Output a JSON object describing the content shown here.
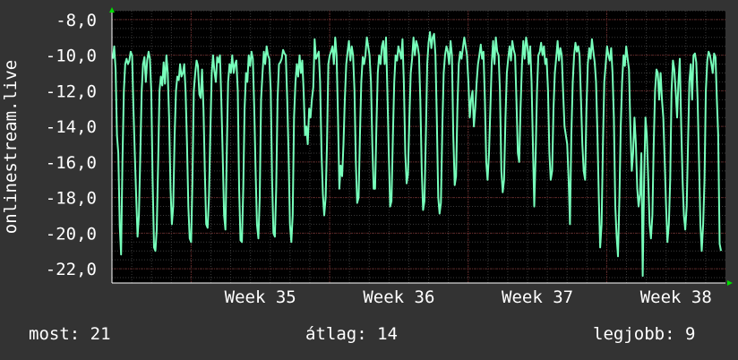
{
  "chart_data": {
    "type": "line",
    "ylabel": "onlinestream.live",
    "ylim": [
      -22.8,
      -7.5
    ],
    "y_ticks": [
      "-8,0",
      "-10,0",
      "-12,0",
      "-14,0",
      "-16,0",
      "-18,0",
      "-20,0",
      "-22,0"
    ],
    "y_tick_values": [
      -8,
      -10,
      -12,
      -14,
      -16,
      -18,
      -20,
      -22
    ],
    "x_labels": [
      "Week 35",
      "Week 36",
      "Week 37",
      "Week 38"
    ],
    "x_label_days": [
      7.5,
      14.5,
      21.5,
      28.5
    ],
    "x_range_days": [
      0,
      31
    ],
    "grid": true,
    "colors": {
      "background": "#333333",
      "plot": "#000000",
      "line": "#77ffbb",
      "grid_minor": "#3a3a3a",
      "grid_major": "#6b2424",
      "axis": "#ffffff",
      "arrow": "#00dd00"
    },
    "series": [
      {
        "values": [
          -10.2,
          -9.5,
          -10.8,
          -14.5,
          -15.5,
          -19.6,
          -21.2,
          -16.0,
          -12.0,
          -10.5,
          -10.2,
          -10.5,
          -10.3,
          -9.8,
          -10.0,
          -13.0,
          -15.5,
          -18.0,
          -20.2,
          -19.0,
          -15.5,
          -12.0,
          -10.5,
          -10.1,
          -11.5,
          -10.3,
          -9.8,
          -10.2,
          -12.0,
          -17.0,
          -20.8,
          -21.0,
          -19.8,
          -16.0,
          -12.0,
          -11.2,
          -11.7,
          -10.4,
          -11.6,
          -10.0,
          -11.0,
          -13.5,
          -17.5,
          -19.5,
          -18.5,
          -14.5,
          -12.0,
          -11.2,
          -11.4,
          -10.5,
          -11.2,
          -11.0,
          -10.5,
          -12.0,
          -15.0,
          -18.5,
          -20.3,
          -20.5,
          -17.0,
          -12.0,
          -11.0,
          -10.3,
          -10.6,
          -12.2,
          -12.4,
          -10.8,
          -13.0,
          -16.5,
          -19.5,
          -19.7,
          -18.0,
          -14.5,
          -11.0,
          -10.0,
          -10.9,
          -11.5,
          -10.1,
          -10.4,
          -10.0,
          -12.5,
          -15.5,
          -19.0,
          -19.8,
          -15.5,
          -11.5,
          -10.5,
          -11.0,
          -10.0,
          -11.0,
          -10.5,
          -10.3,
          -12.0,
          -17.5,
          -20.4,
          -20.5,
          -17.5,
          -13.0,
          -11.0,
          -11.5,
          -10.0,
          -10.6,
          -9.8,
          -10.2,
          -13.0,
          -16.5,
          -19.5,
          -20.3,
          -18.0,
          -12.5,
          -11.0,
          -9.8,
          -10.5,
          -9.5,
          -10.0,
          -10.2,
          -12.0,
          -17.0,
          -20.0,
          -20.2,
          -17.5,
          -12.5,
          -10.5,
          -10.4,
          -10.2,
          -9.7,
          -9.9,
          -10.0,
          -12.5,
          -15.5,
          -19.5,
          -20.5,
          -19.0,
          -13.5,
          -11.5,
          -10.5,
          -11.2,
          -10.0,
          -11.0,
          -10.3,
          -12.0,
          -14.5,
          -14.0,
          -15.0,
          -13.0,
          -13.5,
          -12.5,
          -11.8,
          -9.1,
          -10.2,
          -10.0,
          -9.8,
          -11.5,
          -15.5,
          -17.8,
          -19.0,
          -18.0,
          -15.0,
          -10.5,
          -10.0,
          -9.8,
          -9.5,
          -10.5,
          -9.0,
          -10.0,
          -13.5,
          -17.5,
          -16.2,
          -16.8,
          -15.0,
          -12.5,
          -10.5,
          -9.8,
          -9.2,
          -10.3,
          -9.5,
          -10.0,
          -12.0,
          -16.0,
          -18.3,
          -18.0,
          -14.5,
          -11.5,
          -10.1,
          -10.5,
          -10.0,
          -9.0,
          -9.5,
          -10.0,
          -11.5,
          -15.0,
          -17.5,
          -17.5,
          -14.0,
          -11.0,
          -10.0,
          -10.5,
          -9.5,
          -9.2,
          -10.5,
          -9.0,
          -12.0,
          -15.5,
          -18.5,
          -18.2,
          -14.5,
          -11.5,
          -10.0,
          -10.3,
          -9.5,
          -9.8,
          -10.2,
          -9.1,
          -11.5,
          -15.5,
          -17.2,
          -16.7,
          -13.5,
          -11.0,
          -10.2,
          -9.0,
          -10.0,
          -9.2,
          -9.5,
          -10.0,
          -12.5,
          -16.5,
          -18.7,
          -18.2,
          -14.5,
          -10.5,
          -9.3,
          -8.7,
          -9.6,
          -9.0,
          -8.8,
          -10.0,
          -13.5,
          -18.0,
          -18.9,
          -18.3,
          -14.0,
          -11.0,
          -10.0,
          -9.5,
          -9.8,
          -10.5,
          -9.2,
          -10.0,
          -14.5,
          -17.3,
          -16.8,
          -13.0,
          -10.5,
          -9.8,
          -10.2,
          -9.6,
          -9.0,
          -9.5,
          -10.0,
          -11.5,
          -13.5,
          -12.5,
          -12.0,
          -14.0,
          -13.0,
          -11.5,
          -10.5,
          -10.0,
          -9.4,
          -10.2,
          -9.8,
          -12.5,
          -16.0,
          -17.0,
          -15.5,
          -13.0,
          -10.5,
          -9.2,
          -10.5,
          -9.0,
          -9.8,
          -10.0,
          -12.0,
          -16.5,
          -17.7,
          -17.0,
          -13.5,
          -11.0,
          -10.2,
          -9.5,
          -10.3,
          -9.2,
          -9.7,
          -10.0,
          -12.5,
          -15.5,
          -16.0,
          -13.0,
          -10.5,
          -9.2,
          -10.2,
          -9.0,
          -9.5,
          -10.5,
          -9.5,
          -11.5,
          -15.0,
          -18.5,
          -15.5,
          -12.0,
          -10.0,
          -9.8,
          -9.3,
          -10.0,
          -9.5,
          -10.5,
          -10.2,
          -12.0,
          -15.5,
          -17.0,
          -16.5,
          -13.0,
          -11.0,
          -10.1,
          -9.2,
          -10.3,
          -9.6,
          -10.0,
          -12.0,
          -14.0,
          -14.5,
          -15.0,
          -17.0,
          -19.5,
          -14.5,
          -11.5,
          -10.0,
          -9.3,
          -9.8,
          -9.5,
          -10.0,
          -12.5,
          -15.0,
          -16.5,
          -17.0,
          -13.0,
          -10.5,
          -9.6,
          -10.2,
          -9.1,
          -9.8,
          -10.4,
          -11.5,
          -14.5,
          -18.0,
          -20.8,
          -19.5,
          -15.0,
          -11.5,
          -10.5,
          -9.5,
          -10.0,
          -10.3,
          -9.6,
          -11.0,
          -13.5,
          -18.5,
          -20.2,
          -21.3,
          -18.0,
          -14.0,
          -11.5,
          -10.0,
          -10.6,
          -9.5,
          -10.2,
          -10.8,
          -14.0,
          -16.5,
          -15.5,
          -13.5,
          -15.0,
          -17.5,
          -18.5,
          -17.8,
          -15.5,
          -22.4,
          -17.0,
          -13.5,
          -14.5,
          -17.0,
          -19.5,
          -20.3,
          -19.0,
          -15.0,
          -12.0,
          -10.8,
          -11.0,
          -12.5,
          -11.0,
          -12.5,
          -13.5,
          -16.0,
          -18.5,
          -20.5,
          -19.5,
          -17.0,
          -12.0,
          -10.3,
          -10.8,
          -12.0,
          -13.5,
          -11.5,
          -10.2,
          -14.0,
          -17.0,
          -19.0,
          -19.8,
          -18.5,
          -15.0,
          -11.5,
          -10.5,
          -12.5,
          -10.0,
          -9.9,
          -10.4,
          -12.5,
          -16.0,
          -19.5,
          -21.0,
          -19.5,
          -17.0,
          -12.0,
          -10.3,
          -9.8,
          -10.0,
          -10.5,
          -11.0,
          -9.9,
          -10.1,
          -12.5,
          -14.5,
          -20.6,
          -21.0
        ]
      }
    ]
  },
  "stats": {
    "now": "most: 21",
    "avg": "átlag: 14",
    "best": "legjobb: 9"
  }
}
